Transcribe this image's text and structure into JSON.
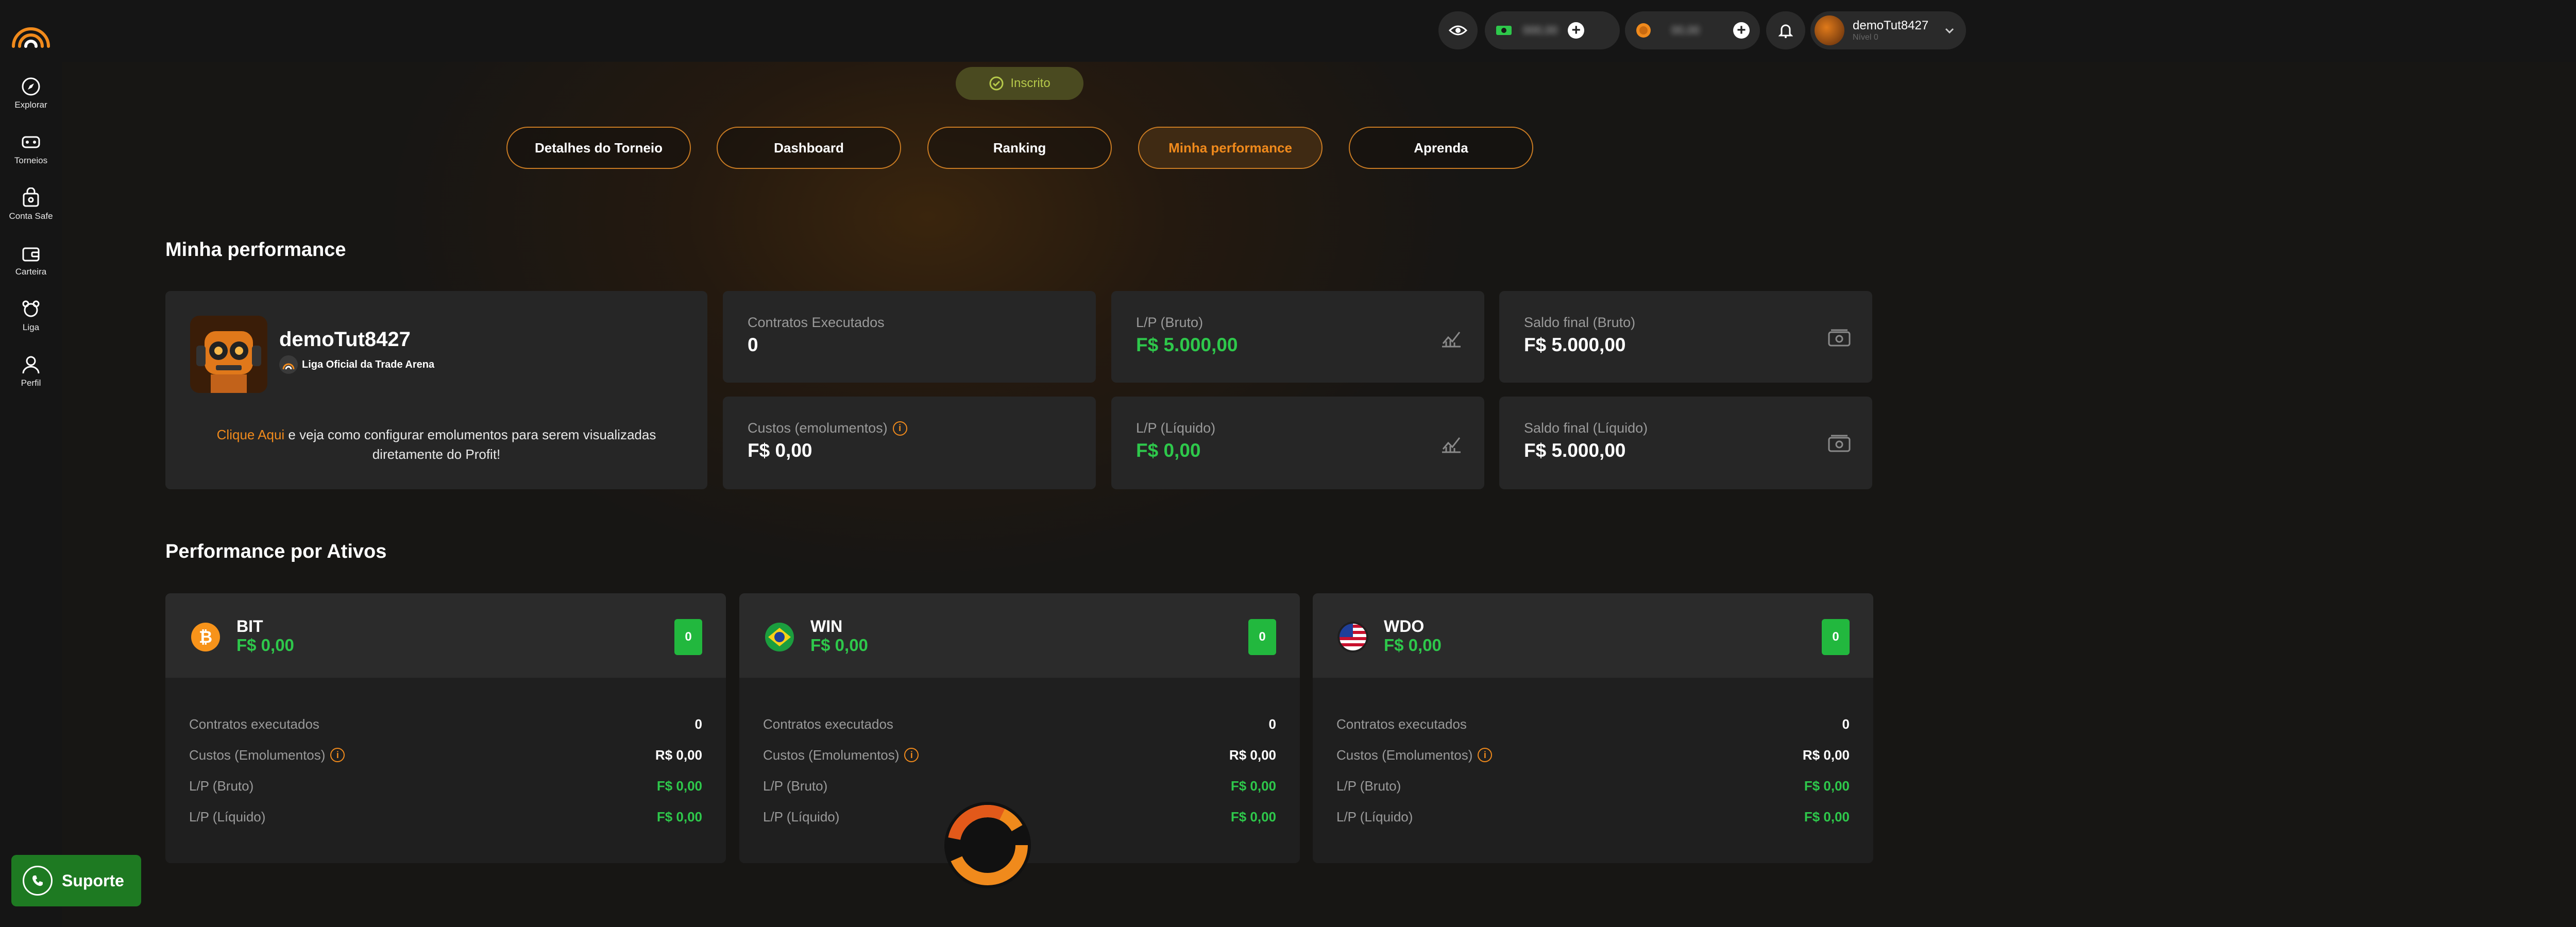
{
  "sidebar": {
    "items": [
      {
        "label": "Explorar",
        "icon": "compass-icon"
      },
      {
        "label": "Torneios",
        "icon": "tournament-icon"
      },
      {
        "label": "Conta Safe",
        "icon": "safe-icon"
      },
      {
        "label": "Carteira",
        "icon": "wallet-icon"
      },
      {
        "label": "Liga",
        "icon": "league-icon"
      },
      {
        "label": "Perfil",
        "icon": "user-icon"
      }
    ]
  },
  "header": {
    "balance_1": "000,00",
    "balance_2": "00,00",
    "username": "demoTut8427",
    "user_subtitle": "Nível 0"
  },
  "status_badge": "Inscrito",
  "tabs": [
    {
      "label": "Detalhes do Torneio",
      "active": false
    },
    {
      "label": "Dashboard",
      "active": false
    },
    {
      "label": "Ranking",
      "active": false
    },
    {
      "label": "Minha performance",
      "active": true
    },
    {
      "label": "Aprenda",
      "active": false
    }
  ],
  "performance": {
    "title": "Minha performance",
    "profile": {
      "username": "demoTut8427",
      "league": "Liga Oficial da Trade Arena",
      "link_text": "Clique Aqui",
      "note_rest": " e veja como configurar emolumentos para serem visualizadas",
      "note_line2": "diretamente do Profit!"
    },
    "stats": [
      {
        "label": "Contratos Executados",
        "value": "0",
        "green": false
      },
      {
        "label": "L/P (Bruto)",
        "value": "F$ 5.000,00",
        "green": true,
        "icon": "chart-icon"
      },
      {
        "label": "Saldo final (Bruto)",
        "value": "F$ 5.000,00",
        "green": false,
        "icon": "cash-icon"
      },
      {
        "label": "Custos (emolumentos)",
        "value": "F$ 0,00",
        "green": false,
        "info": true
      },
      {
        "label": "L/P (Líquido)",
        "value": "F$ 0,00",
        "green": true,
        "icon": "chart-icon"
      },
      {
        "label": "Saldo final (Líquido)",
        "value": "F$ 5.000,00",
        "green": false,
        "icon": "cash-icon"
      }
    ]
  },
  "assets_section": {
    "title": "Performance por Ativos",
    "assets": [
      {
        "name": "BIT",
        "value": "F$ 0,00",
        "badge": "0",
        "icon": "bitcoin-icon",
        "rows": [
          {
            "label": "Contratos executados",
            "value": "0"
          },
          {
            "label": "Custos (Emolumentos)",
            "value": "R$ 0,00"
          },
          {
            "label": "L/P (Bruto)",
            "value": "F$ 0,00"
          },
          {
            "label": "L/P (Líquido)",
            "value": "F$ 0,00"
          }
        ]
      },
      {
        "name": "WIN",
        "value": "F$ 0,00",
        "badge": "0",
        "icon": "brazil-flag-icon",
        "rows": [
          {
            "label": "Contratos executados",
            "value": "0"
          },
          {
            "label": "Custos (Emolumentos)",
            "value": "R$ 0,00"
          },
          {
            "label": "L/P (Bruto)",
            "value": "F$ 0,00"
          },
          {
            "label": "L/P (Líquido)",
            "value": "F$ 0,00"
          }
        ]
      },
      {
        "name": "WDO",
        "value": "F$ 0,00",
        "badge": "0",
        "icon": "usa-flag-icon",
        "rows": [
          {
            "label": "Contratos executados",
            "value": "0"
          },
          {
            "label": "Custos (Emolumentos)",
            "value": "R$ 0,00"
          },
          {
            "label": "L/P (Bruto)",
            "value": "F$ 0,00"
          },
          {
            "label": "L/P (Líquido)",
            "value": "F$ 0,00"
          }
        ]
      }
    ]
  },
  "support_label": "Suporte",
  "colors": {
    "accent": "#f08a1c",
    "positive": "#2ec84b",
    "support": "#1e7a22"
  }
}
